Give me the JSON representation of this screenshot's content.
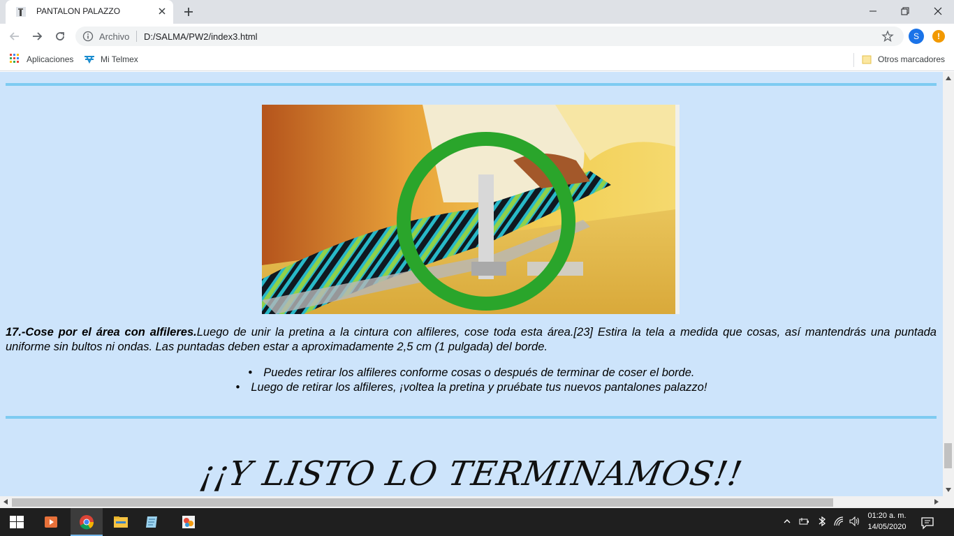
{
  "browser": {
    "tab": {
      "title": "PANTALON PALAZZO"
    },
    "address": {
      "scheme_label": "Archivo",
      "url": "D:/SALMA/PW2/index3.html"
    },
    "profile_initial": "S",
    "alert_symbol": "!",
    "bookmarks": {
      "apps_label": "Aplicaciones",
      "telmex_label": "Mi Telmex",
      "other_label": "Otros marcadores"
    }
  },
  "page": {
    "step_bold": "17.-Cose por el área con alfileres.",
    "step_text": "Luego de unir la pretina a la cintura con alfileres, cose toda esta área.[23] Estira la tela a medida que cosas, así mantendrás una puntada uniforme sin bultos ni ondas. Las puntadas deben estar a aproximadamente 2,5 cm (1 pulgada) del borde.",
    "tips": [
      "Puedes retirar los alfileres conforme cosas o después de terminar de coser el borde.",
      "Luego de retirar los alfileres, ¡voltea la pretina y pruébate tus nuevos pantalones palazzo!"
    ],
    "closing_heading": "¡¡Y LISTO LO TERMINAMOS!!",
    "colors": {
      "background": "#cde4fb",
      "rule": "#7ecbf1",
      "circle": "#2aa52b"
    }
  },
  "taskbar": {
    "time": "01:20 a. m.",
    "date": "14/05/2020",
    "apps": [
      "windows-start",
      "media-player",
      "chrome",
      "file-explorer",
      "notepad",
      "paint"
    ]
  }
}
